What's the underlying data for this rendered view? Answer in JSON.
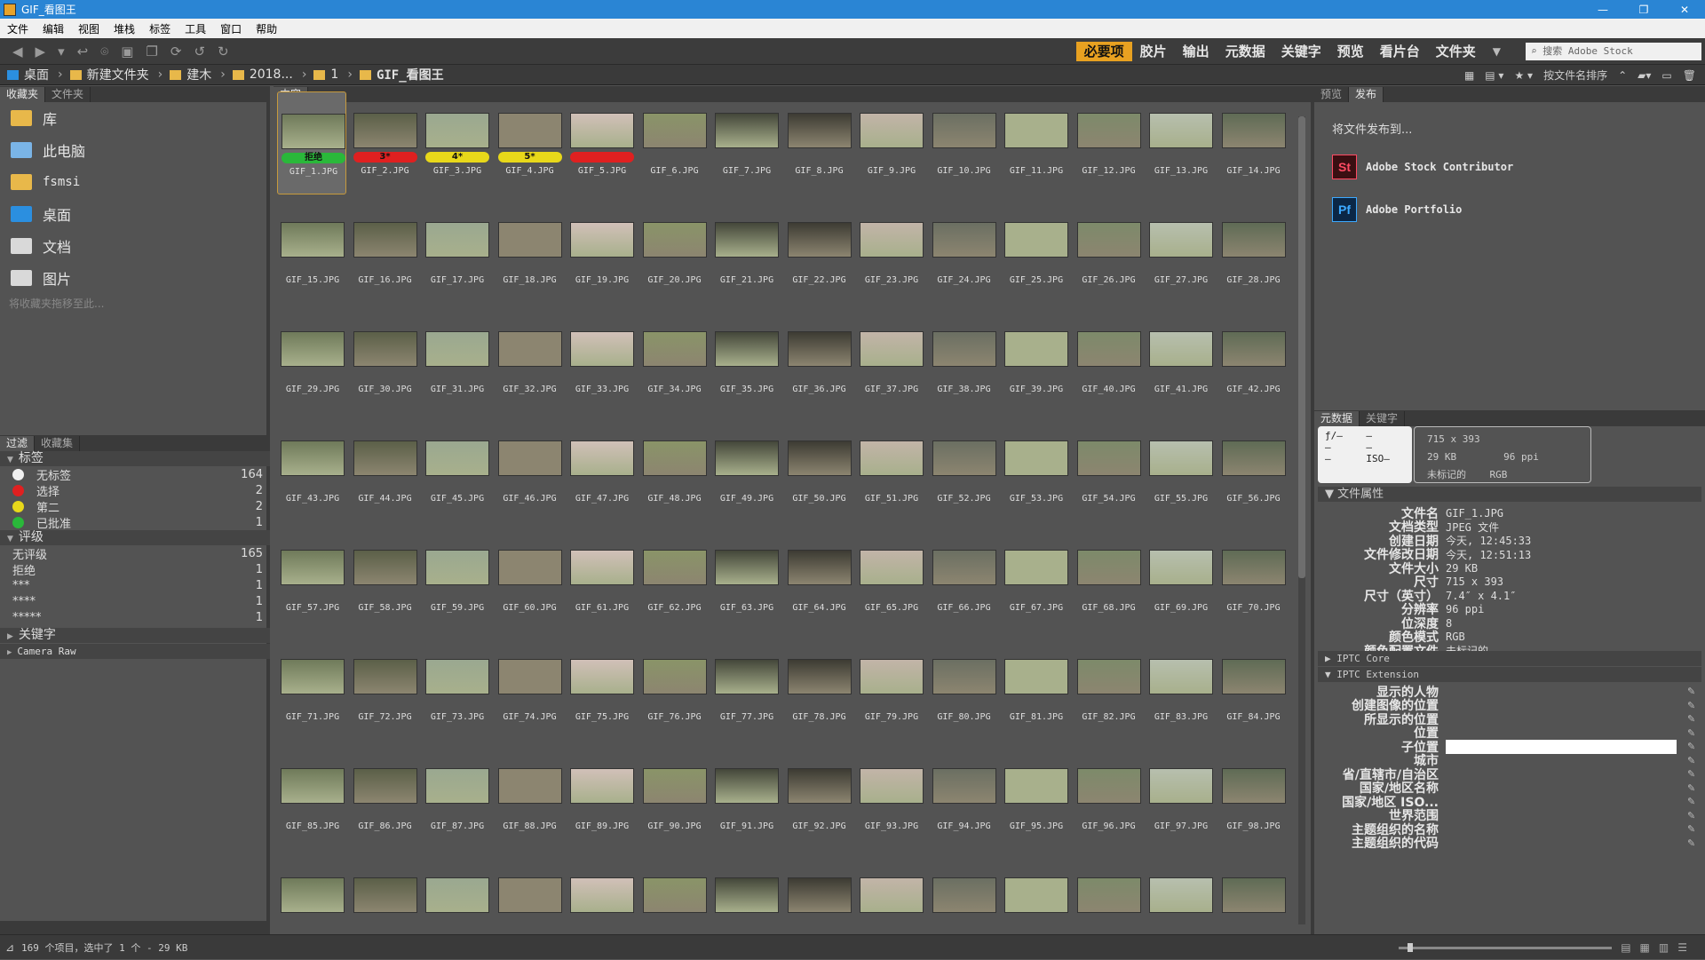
{
  "window": {
    "title": "GIF_看图王",
    "min": "—",
    "max": "❐",
    "close": "✕"
  },
  "menu": [
    "文件",
    "编辑",
    "视图",
    "堆栈",
    "标签",
    "工具",
    "窗口",
    "帮助"
  ],
  "toolbar": {
    "workspaces": [
      "必要项",
      "胶片",
      "输出",
      "元数据",
      "关键字",
      "预览",
      "看片台",
      "文件夹"
    ],
    "active_workspace": "必要项",
    "search_placeholder": "搜索 Adobe Stock"
  },
  "path": [
    "桌面",
    "新建文件夹",
    "建木",
    "2018...",
    "1",
    "GIF_看图王"
  ],
  "path_right": {
    "sort": "按文件名排序"
  },
  "left_tabs": [
    "收藏夹",
    "文件夹"
  ],
  "favorites": [
    {
      "label": "库",
      "icon": "library-folder-icon"
    },
    {
      "label": "此电脑",
      "icon": "computer-icon"
    },
    {
      "label": "fsmsi",
      "icon": "user-folder-icon"
    },
    {
      "label": "桌面",
      "icon": "desktop-icon"
    },
    {
      "label": "文档",
      "icon": "documents-icon"
    },
    {
      "label": "图片",
      "icon": "pictures-icon"
    }
  ],
  "favorites_hint": "将收藏夹拖移至此...",
  "filter_tabs": [
    "过滤",
    "收藏集"
  ],
  "filters": {
    "labels_title": "标签",
    "labels": [
      {
        "label": "无标签",
        "count": "164",
        "color": "#f0f0f0"
      },
      {
        "label": "选择",
        "count": "2",
        "color": "#e02020"
      },
      {
        "label": "第二",
        "count": "2",
        "color": "#e8d81a"
      },
      {
        "label": "已批准",
        "count": "1",
        "color": "#2ab83a"
      }
    ],
    "rating_title": "评级",
    "ratings": [
      {
        "label": "无评级",
        "count": "165"
      },
      {
        "label": "拒绝",
        "count": "1"
      },
      {
        "label": "***",
        "count": "1"
      },
      {
        "label": "****",
        "count": "1"
      },
      {
        "label": "*****",
        "count": "1"
      }
    ],
    "keywords_title": "关键字",
    "camera_raw_title": "Camera Raw"
  },
  "content_tab": "内容",
  "thumbs": {
    "first_row_ratings": [
      "拒绝",
      "3*",
      "4*",
      "5*",
      ""
    ],
    "first_row_colors": [
      "#2ab83a",
      "#e02020",
      "#e8d81a",
      "#e8d81a",
      "#e02020"
    ],
    "names": [
      "GIF_1.JPG",
      "GIF_2.JPG",
      "GIF_3.JPG",
      "GIF_4.JPG",
      "GIF_5.JPG",
      "GIF_6.JPG",
      "GIF_7.JPG",
      "GIF_8.JPG",
      "GIF_9.JPG",
      "GIF_10.JPG",
      "GIF_11.JPG",
      "GIF_12.JPG",
      "GIF_13.JPG",
      "GIF_14.JPG",
      "GIF_15.JPG",
      "GIF_16.JPG",
      "GIF_17.JPG",
      "GIF_18.JPG",
      "GIF_19.JPG",
      "GIF_20.JPG",
      "GIF_21.JPG",
      "GIF_22.JPG",
      "GIF_23.JPG",
      "GIF_24.JPG",
      "GIF_25.JPG",
      "GIF_26.JPG",
      "GIF_27.JPG",
      "GIF_28.JPG",
      "GIF_29.JPG",
      "GIF_30.JPG",
      "GIF_31.JPG",
      "GIF_32.JPG",
      "GIF_33.JPG",
      "GIF_34.JPG",
      "GIF_35.JPG",
      "GIF_36.JPG",
      "GIF_37.JPG",
      "GIF_38.JPG",
      "GIF_39.JPG",
      "GIF_40.JPG",
      "GIF_41.JPG",
      "GIF_42.JPG",
      "GIF_43.JPG",
      "GIF_44.JPG",
      "GIF_45.JPG",
      "GIF_46.JPG",
      "GIF_47.JPG",
      "GIF_48.JPG",
      "GIF_49.JPG",
      "GIF_50.JPG",
      "GIF_51.JPG",
      "GIF_52.JPG",
      "GIF_53.JPG",
      "GIF_54.JPG",
      "GIF_55.JPG",
      "GIF_56.JPG",
      "GIF_57.JPG",
      "GIF_58.JPG",
      "GIF_59.JPG",
      "GIF_60.JPG",
      "GIF_61.JPG",
      "GIF_62.JPG",
      "GIF_63.JPG",
      "GIF_64.JPG",
      "GIF_65.JPG",
      "GIF_66.JPG",
      "GIF_67.JPG",
      "GIF_68.JPG",
      "GIF_69.JPG",
      "GIF_70.JPG",
      "GIF_71.JPG",
      "GIF_72.JPG",
      "GIF_73.JPG",
      "GIF_74.JPG",
      "GIF_75.JPG",
      "GIF_76.JPG",
      "GIF_77.JPG",
      "GIF_78.JPG",
      "GIF_79.JPG",
      "GIF_80.JPG",
      "GIF_81.JPG",
      "GIF_82.JPG",
      "GIF_83.JPG",
      "GIF_84.JPG",
      "GIF_85.JPG",
      "GIF_86.JPG",
      "GIF_87.JPG",
      "GIF_88.JPG",
      "GIF_89.JPG",
      "GIF_90.JPG",
      "GIF_91.JPG",
      "GIF_92.JPG",
      "GIF_93.JPG",
      "GIF_94.JPG",
      "GIF_95.JPG",
      "GIF_96.JPG",
      "GIF_97.JPG",
      "GIF_98.JPG",
      "",
      "",
      "",
      "",
      "",
      "",
      "",
      "",
      "",
      "",
      "",
      "",
      "",
      ""
    ],
    "palette": [
      "#6f7a5a",
      "#8a9468",
      "#a8b08c",
      "#5b5f48",
      "#44473a",
      "#7d8a6a",
      "#9aa890",
      "#3d3b33",
      "#b7bfae",
      "#8c8570",
      "#c2b4a8",
      "#5f6b55",
      "#d1c0b8",
      "#6b6f62"
    ]
  },
  "right_tabs": [
    "预览",
    "发布"
  ],
  "publish": {
    "title": "将文件发布到...",
    "targets": [
      {
        "badge": "St",
        "label": "Adobe Stock Contributor"
      },
      {
        "badge": "Pf",
        "label": "Adobe Portfolio"
      }
    ]
  },
  "meta_tabs": [
    "元数据",
    "关键字"
  ],
  "meta_summary": {
    "aperture": "ƒ/—",
    "shutter": "—",
    "ev1": "—",
    "ev2": "—",
    "wb": "—",
    "iso": "ISO—",
    "dims": "715 x 393",
    "size": "29 KB",
    "ppi": "96 ppi",
    "profile": "未标记的",
    "mode": "RGB"
  },
  "file_props_title": "文件属性",
  "file_props": [
    {
      "k": "文件名",
      "v": "GIF_1.JPG"
    },
    {
      "k": "文档类型",
      "v": "JPEG 文件"
    },
    {
      "k": "创建日期",
      "v": "今天, 12:45:33"
    },
    {
      "k": "文件修改日期",
      "v": "今天, 12:51:13"
    },
    {
      "k": "文件大小",
      "v": "29 KB"
    },
    {
      "k": "尺寸",
      "v": "715 x 393"
    },
    {
      "k": "尺寸（英寸）",
      "v": "7.4″ x 4.1″"
    },
    {
      "k": "分辨率",
      "v": "96 ppi"
    },
    {
      "k": "位深度",
      "v": "8"
    },
    {
      "k": "颜色模式",
      "v": "RGB"
    },
    {
      "k": "颜色配置文件",
      "v": "未标记的"
    }
  ],
  "iptc_core": "IPTC Core",
  "iptc_ext": "IPTC Extension",
  "iptc_fields": [
    "显示的人物",
    "创建图像的位置",
    "所显示的位置",
    "位置",
    "子位置",
    "城市",
    "省/直辖市/自治区",
    "国家/地区名称",
    "国家/地区 ISO...",
    "世界范围",
    "主题组织的名称",
    "主题组织的代码"
  ],
  "status": {
    "text": "169 个项目，选中了 1 个 - 29 KB"
  }
}
